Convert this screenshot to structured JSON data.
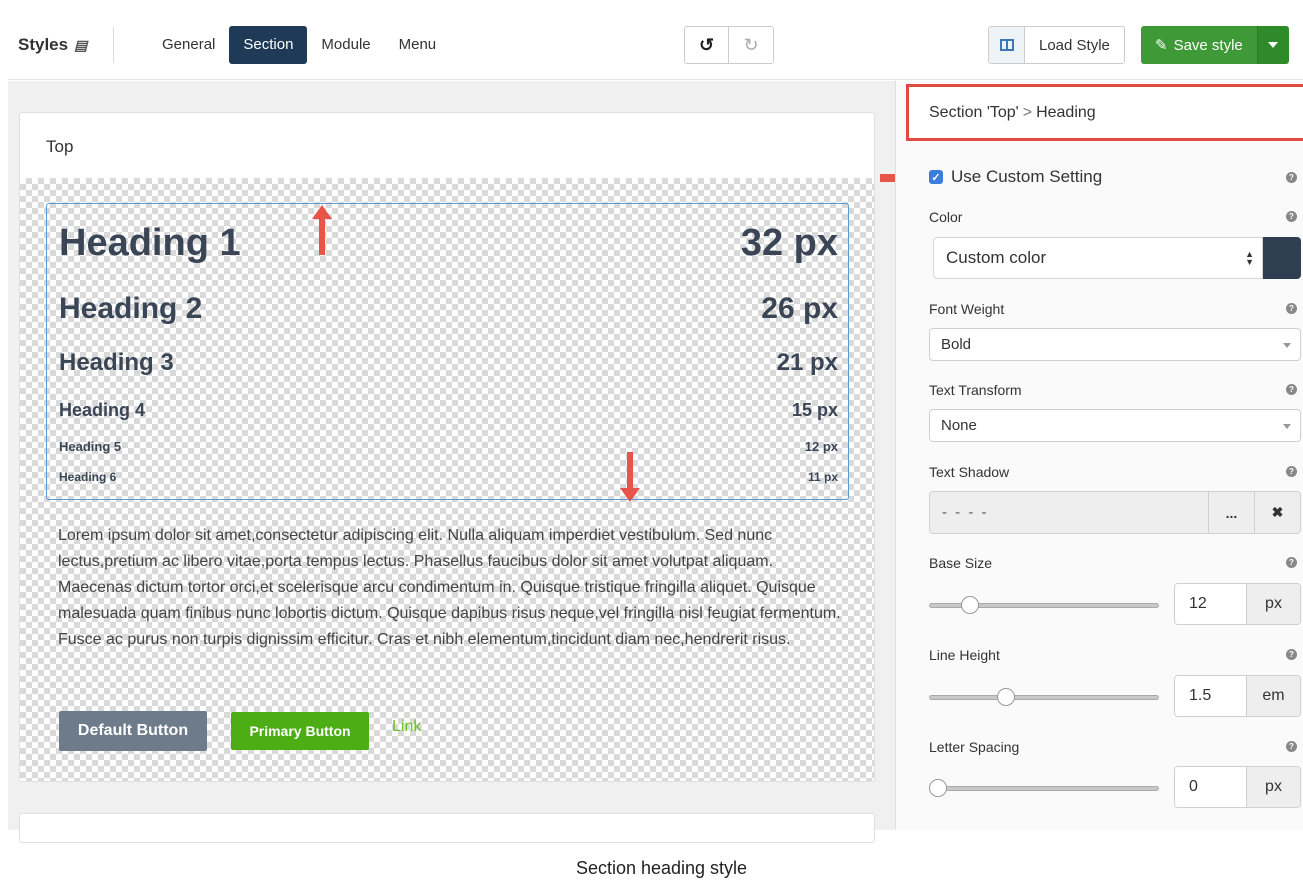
{
  "header": {
    "brand": "Styles",
    "tabs": [
      {
        "label": "General",
        "active": false
      },
      {
        "label": "Section",
        "active": true
      },
      {
        "label": "Module",
        "active": false
      },
      {
        "label": "Menu",
        "active": false
      }
    ],
    "undo_icon": "undo-icon",
    "redo_icon": "redo-icon",
    "load_style_label": "Load Style",
    "save_style_label": "Save style"
  },
  "preview": {
    "card_title": "Top",
    "headings": [
      {
        "label": "Heading 1",
        "size": "32 px"
      },
      {
        "label": "Heading 2",
        "size": "26 px"
      },
      {
        "label": "Heading 3",
        "size": "21 px"
      },
      {
        "label": "Heading 4",
        "size": "15 px"
      },
      {
        "label": "Heading 5",
        "size": "12 px"
      },
      {
        "label": "Heading 6",
        "size": "11 px"
      }
    ],
    "lorem": "Lorem ipsum dolor sit amet,consectetur adipiscing elit. Nulla aliquam imperdiet vestibulum. Sed nunc lectus,pretium ac libero vitae,porta tempus lectus. Phasellus faucibus dolor sit amet volutpat aliquam. Maecenas dictum tortor orci,et scelerisque arcu condimentum in. Quisque tristique fringilla aliquet. Quisque malesuada quam finibus nunc lobortis dictum. Quisque dapibus risus neque,vel fringilla nisl feugiat fermentum. Fusce ac purus non turpis dignissim efficitur. Cras et nibh elementum,tincidunt diam nec,hendrerit risus.",
    "default_button": "Default Button",
    "primary_button": "Primary Button",
    "link": "Link"
  },
  "panel": {
    "breadcrumb_section": "Section 'Top'",
    "breadcrumb_sep": ">",
    "breadcrumb_item": "Heading",
    "use_custom_label": "Use Custom Setting",
    "use_custom_checked": true,
    "color_label": "Color",
    "color_value": "Custom color",
    "color_swatch": "#2f3e50",
    "font_weight_label": "Font Weight",
    "font_weight_value": "Bold",
    "text_transform_label": "Text Transform",
    "text_transform_value": "None",
    "text_shadow_label": "Text Shadow",
    "text_shadow_value": "- - - -",
    "text_shadow_more": "...",
    "text_shadow_clear": "✖",
    "base_size_label": "Base Size",
    "base_size_value": "12",
    "base_size_unit": "px",
    "base_size_level": 0.15,
    "line_height_label": "Line Height",
    "line_height_value": "1.5",
    "line_height_unit": "em",
    "line_height_level": 0.32,
    "letter_spacing_label": "Letter Spacing",
    "letter_spacing_value": "0",
    "letter_spacing_unit": "px",
    "letter_spacing_level": 0.0
  },
  "caption": "Section heading style",
  "colors": {
    "active_tab": "#1e3a57",
    "save_green": "#3d9a37",
    "highlight_red": "#e04a3f",
    "primary_green": "#4cae14"
  }
}
